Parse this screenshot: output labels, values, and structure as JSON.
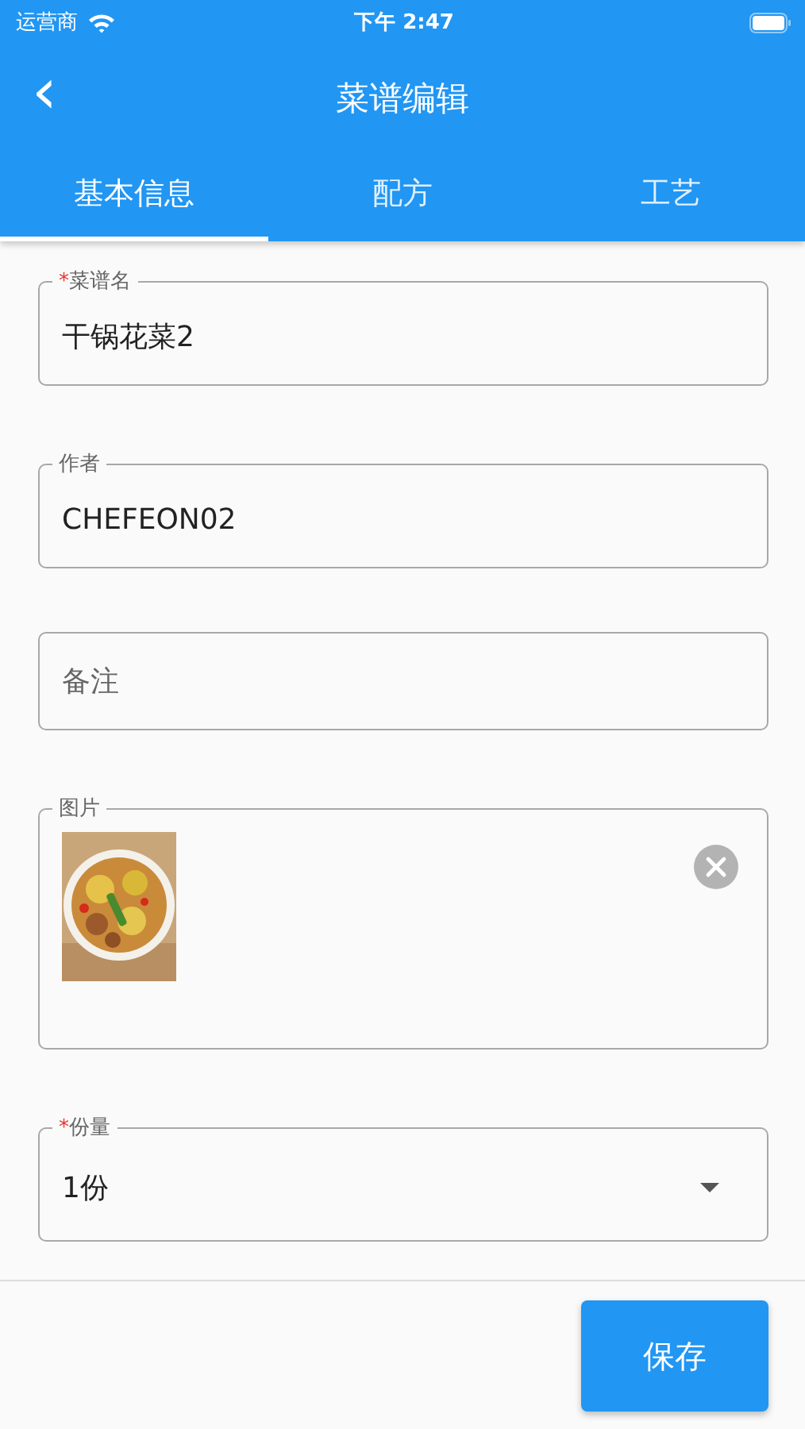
{
  "status_bar": {
    "carrier": "运营商",
    "time": "下午 2:47"
  },
  "header": {
    "back": "‹",
    "title": "菜谱编辑"
  },
  "tabs": [
    {
      "label": "基本信息",
      "selected": true
    },
    {
      "label": "配方",
      "selected": false
    },
    {
      "label": "工艺",
      "selected": false
    }
  ],
  "fields": [
    {
      "kind": "text",
      "label": "菜谱名",
      "required_mark": "*",
      "value": "干锅花菜2"
    },
    {
      "kind": "text",
      "label": "作者",
      "value": "CHEFEON02"
    },
    {
      "kind": "text",
      "placeholder": "备注"
    },
    {
      "label": "图片"
    },
    {
      "kind": "select",
      "label": "份量",
      "required_mark": "*",
      "value": "1份"
    }
  ],
  "footer": {
    "save_button": "保存"
  }
}
